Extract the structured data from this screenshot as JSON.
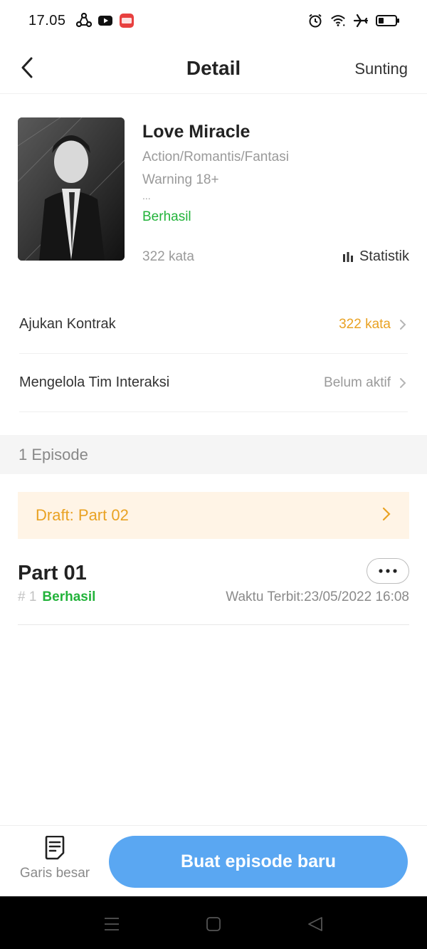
{
  "status_bar": {
    "time": "17.05",
    "left_icons": [
      "share-icon",
      "youtube-icon",
      "mangatoon-icon"
    ],
    "mangatoon_label": "MANGA TOON",
    "right_icons": [
      "alarm-icon",
      "wifi-icon",
      "airplane-icon",
      "battery-icon"
    ]
  },
  "header": {
    "title": "Detail",
    "edit_label": "Sunting",
    "back_icon": "chevron-left-icon"
  },
  "book": {
    "title": "Love Miracle",
    "genre": "Action/Romantis/Fantasi",
    "description": "Warning 18+",
    "ellipsis": "...",
    "status": "Berhasil",
    "word_count": "322 kata",
    "stats_label": "Statistik",
    "stats_icon": "bar-chart-icon"
  },
  "menu": {
    "contract": {
      "label": "Ajukan Kontrak",
      "value": "322 kata",
      "value_color": "#e9a223"
    },
    "team": {
      "label": "Mengelola Tim Interaksi",
      "value": "Belum aktif",
      "value_color": "#9a9a9a"
    }
  },
  "episodes": {
    "count_label": "1 Episode",
    "draft_label": "Draft: Part 02",
    "items": [
      {
        "title": "Part 01",
        "number": "# 1",
        "status": "Berhasil",
        "publish_label": "Waktu Terbit:",
        "publish_time": "23/05/2022 16:08"
      }
    ]
  },
  "bottom_bar": {
    "outline_label": "Garis besar",
    "outline_icon": "document-list-icon",
    "create_label": "Buat episode baru"
  },
  "nav_bar": {
    "icons": [
      "menu-icon",
      "home-icon",
      "back-triangle-icon"
    ]
  },
  "colors": {
    "accent_blue": "#5aa7f2",
    "success_green": "#22b33a",
    "warning_orange": "#e9a223",
    "draft_bg": "#fff4e6"
  }
}
